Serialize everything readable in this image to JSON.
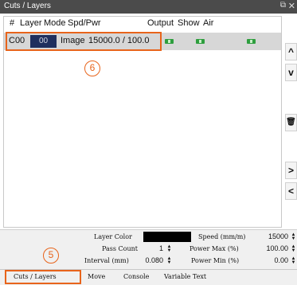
{
  "window": {
    "title": "Cuts / Layers",
    "float_icon": "float-icon",
    "close_icon": "close-icon"
  },
  "table": {
    "headers": [
      "#",
      "Layer",
      "Mode",
      "Spd/Pwr",
      "Output",
      "Show",
      "Air"
    ],
    "rows": [
      {
        "index": "C00",
        "layer": "00",
        "mode": "Image",
        "spd_pwr": "15000.0 / 100.0",
        "output": true,
        "show": true,
        "air": true
      }
    ]
  },
  "callouts": {
    "table_row": "6",
    "tab": "5"
  },
  "side_buttons": [
    "chevron-up-icon",
    "chevron-down-icon",
    "trash-icon",
    "chevron-right-icon",
    "chevron-left-icon"
  ],
  "side_glyphs": [
    "^",
    "v",
    "🗑",
    ">",
    "<"
  ],
  "settings": {
    "layer_color_label": "Layer Color",
    "layer_color": "#000000",
    "pass_count_label": "Pass Count",
    "pass_count": "1",
    "interval_label": "Interval (mm)",
    "interval": "0.080",
    "speed_label": "Speed (mm/m)",
    "speed": "15000",
    "power_max_label": "Power Max (%)",
    "power_max": "100.00",
    "power_min_label": "Power Min (%)",
    "power_min": "0.00"
  },
  "tabs": [
    "Cuts / Layers",
    "Move",
    "Console",
    "Variable Text"
  ],
  "colors": {
    "highlight": "#e8641b",
    "layer_swatch": "#1f2f5e",
    "toggle_on": "#2e9e3e",
    "titlebar": "#4b4b4b"
  }
}
